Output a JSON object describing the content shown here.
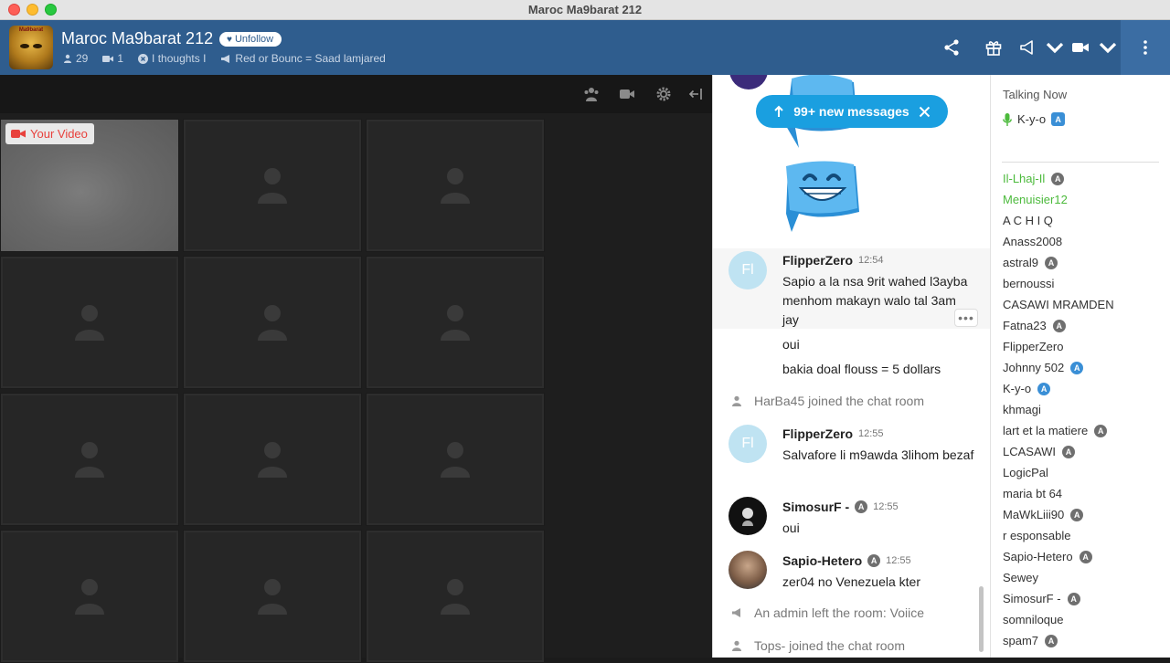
{
  "window": {
    "title": "Maroc Ma9barat 212"
  },
  "header": {
    "room_title": "Maroc Ma9barat 212",
    "unfollow_label": "Unfollow",
    "logo_text": "Ma9barat",
    "users_count": "29",
    "cams_count": "1",
    "status_text": "I thoughts I",
    "announcement": "Red or Bounc = Saad lamjared"
  },
  "video": {
    "your_video_label": "Your Video"
  },
  "chat": {
    "new_messages_label": "99+ new messages",
    "messages": [
      {
        "initials": "Fl",
        "name": "FlipperZero",
        "time": "12:54",
        "text": "Sapio a la nsa 9rit wahed l3ayba menhom makayn walo tal 3am jay"
      },
      {
        "text": "oui"
      },
      {
        "text": "bakia doal flouss = 5 dollars"
      },
      {
        "system": "HarBa45 joined the chat room"
      },
      {
        "initials": "Fl",
        "name": "FlipperZero",
        "time": "12:55",
        "text": "Salvafore li m9awda 3lihom bezaf"
      },
      {
        "name": "SimosurF -",
        "badge": "A",
        "time": "12:55",
        "text": "oui"
      },
      {
        "name": "Sapio-Hetero",
        "badge": "A",
        "time": "12:55",
        "text": "zer04 no Venezuela kter"
      },
      {
        "system": "An admin left the room: Voiice"
      },
      {
        "system": "Tops- joined the chat room"
      }
    ]
  },
  "users": {
    "talking_now_label": "Talking Now",
    "talker": {
      "name": "K-y-o",
      "badge": "A"
    },
    "list": [
      {
        "name": "Il-Lhaj-Il",
        "badge": "A",
        "color": "green"
      },
      {
        "name": "Menuisier12",
        "color": "green"
      },
      {
        "name": "A C H I Q"
      },
      {
        "name": "Anass2008"
      },
      {
        "name": "astral9",
        "badge": "A"
      },
      {
        "name": "bernoussi"
      },
      {
        "name": "CASAWI MRAMDEN"
      },
      {
        "name": "Fatna23",
        "badge": "A"
      },
      {
        "name": "FlipperZero"
      },
      {
        "name": "Johnny 502",
        "badge": "A",
        "badge_color": "blue"
      },
      {
        "name": "K-y-o",
        "badge": "A",
        "badge_color": "blue"
      },
      {
        "name": "khmagi"
      },
      {
        "name": "lart et la matiere",
        "badge": "A"
      },
      {
        "name": "LCASAWI",
        "badge": "A"
      },
      {
        "name": "LogicPal"
      },
      {
        "name": "maria bt 64"
      },
      {
        "name": "MaWkLiii90",
        "badge": "A"
      },
      {
        "name": "r esponsable"
      },
      {
        "name": "Sapio-Hetero",
        "badge": "A"
      },
      {
        "name": "Sewey"
      },
      {
        "name": "SimosurF -",
        "badge": "A"
      },
      {
        "name": "somniloque"
      },
      {
        "name": "spam7",
        "badge": "A"
      }
    ]
  },
  "colors": {
    "header_bg": "#2f5d8e",
    "accent": "#1a9fe0",
    "green": "#4cba3c",
    "your_video_red": "#e8413c"
  }
}
